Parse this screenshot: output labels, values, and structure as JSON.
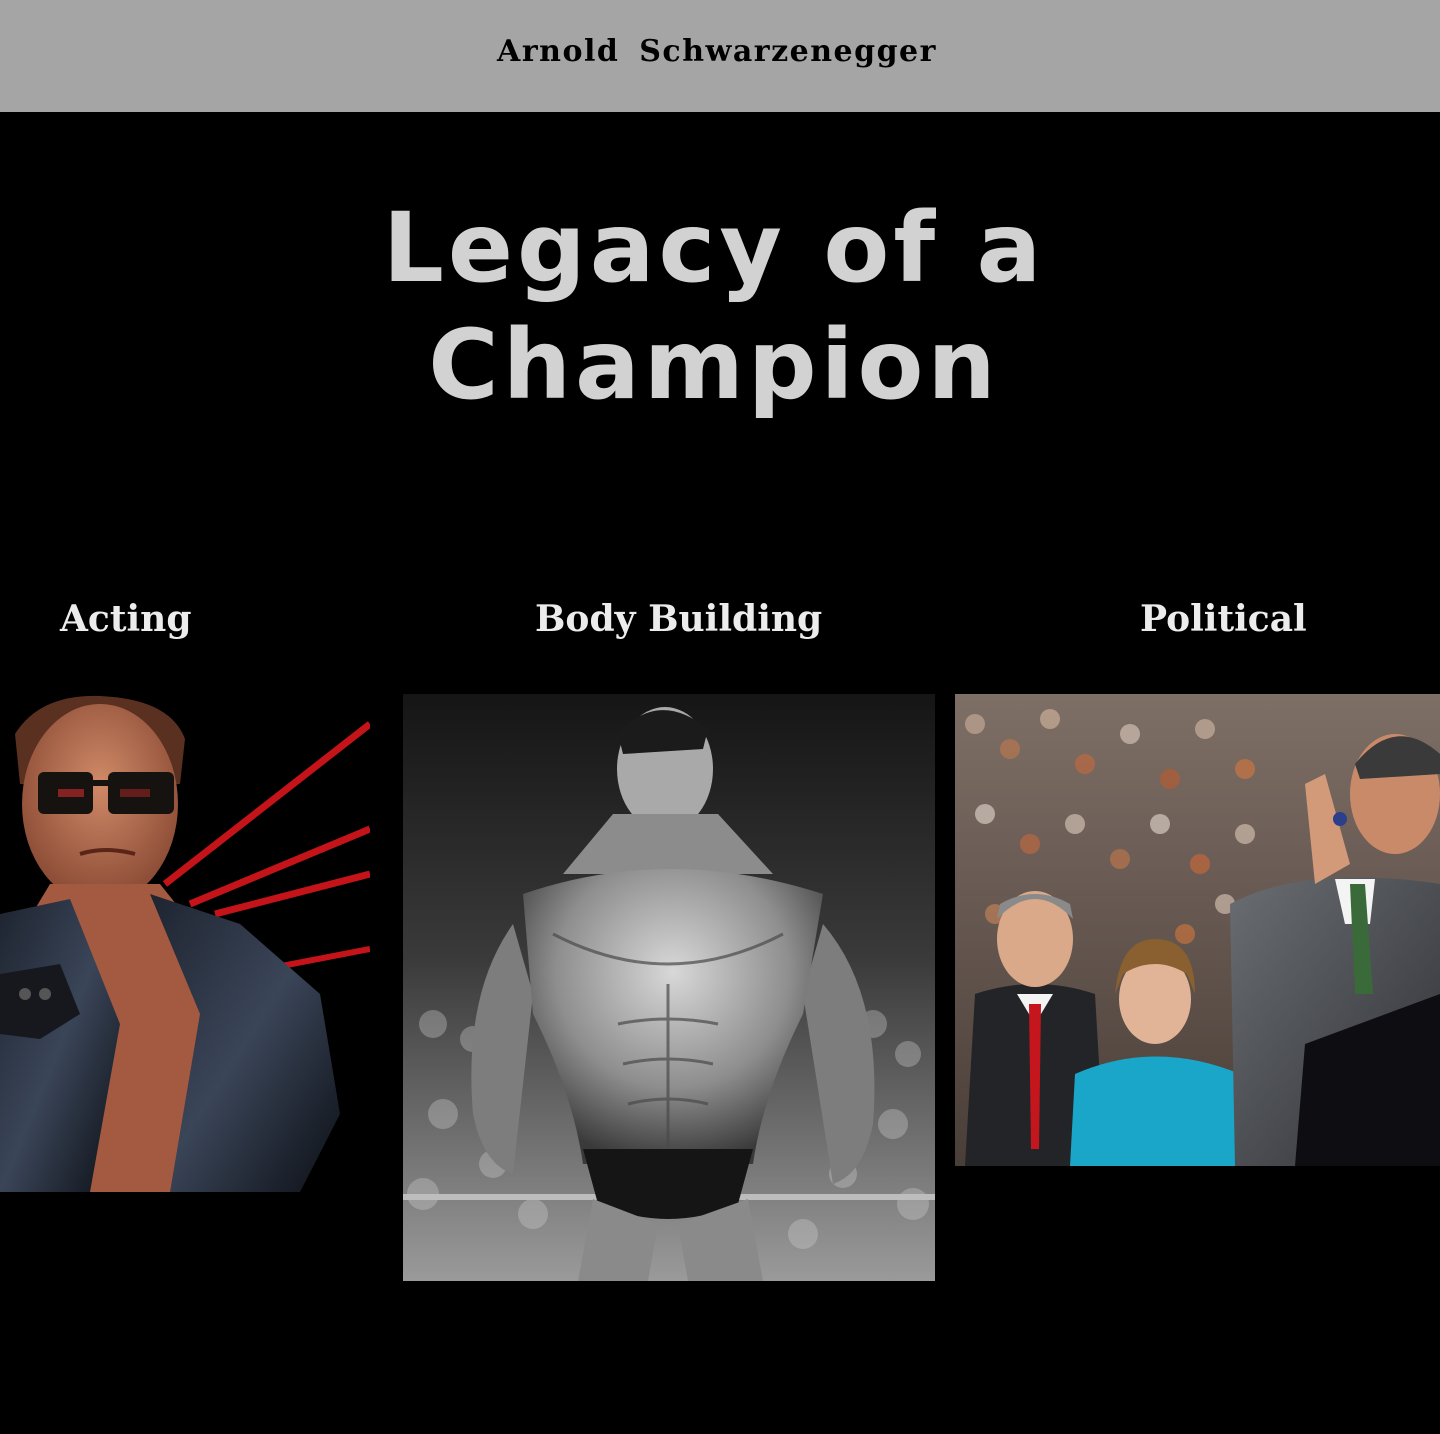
{
  "header": {
    "brand": "Arnold  Schwarzenegger"
  },
  "hero": {
    "title_line1": "Legacy of a",
    "title_line2": "Champion"
  },
  "categories": [
    {
      "label": "Acting",
      "image": "acting-photo"
    },
    {
      "label": "Body Building",
      "image": "bodybuilding-photo"
    },
    {
      "label": "Political",
      "image": "political-photo"
    }
  ],
  "colors": {
    "header_bg": "#a5a5a5",
    "page_bg": "#000000",
    "title": "#d2d2d2",
    "heading": "#ececec"
  }
}
